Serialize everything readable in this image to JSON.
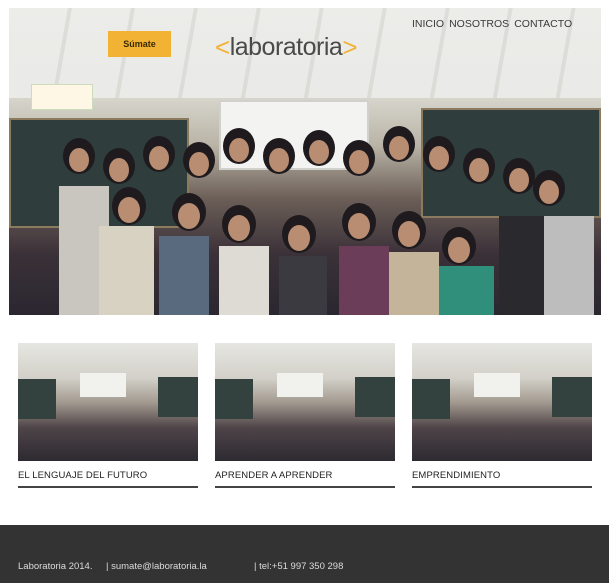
{
  "header": {
    "cta_label": "Súmate",
    "logo_text": "laboratoria",
    "logo_left_bracket": "<",
    "logo_right_bracket": ">",
    "nav": [
      "INICIO",
      "NOSOTROS",
      "CONTACTO"
    ]
  },
  "colors": {
    "accent": "#f2b233",
    "footer_bg": "#333333",
    "text": "#222222"
  },
  "cards": [
    {
      "title": "EL LENGUAJE DEL FUTURO"
    },
    {
      "title": "APRENDER A APRENDER"
    },
    {
      "title": "EMPRENDIMIENTO"
    }
  ],
  "footer": {
    "copyright": "Laboratoria 2014.",
    "email": "| sumate@laboratoria.la",
    "phone": "| tel:+51 997 350 298"
  }
}
